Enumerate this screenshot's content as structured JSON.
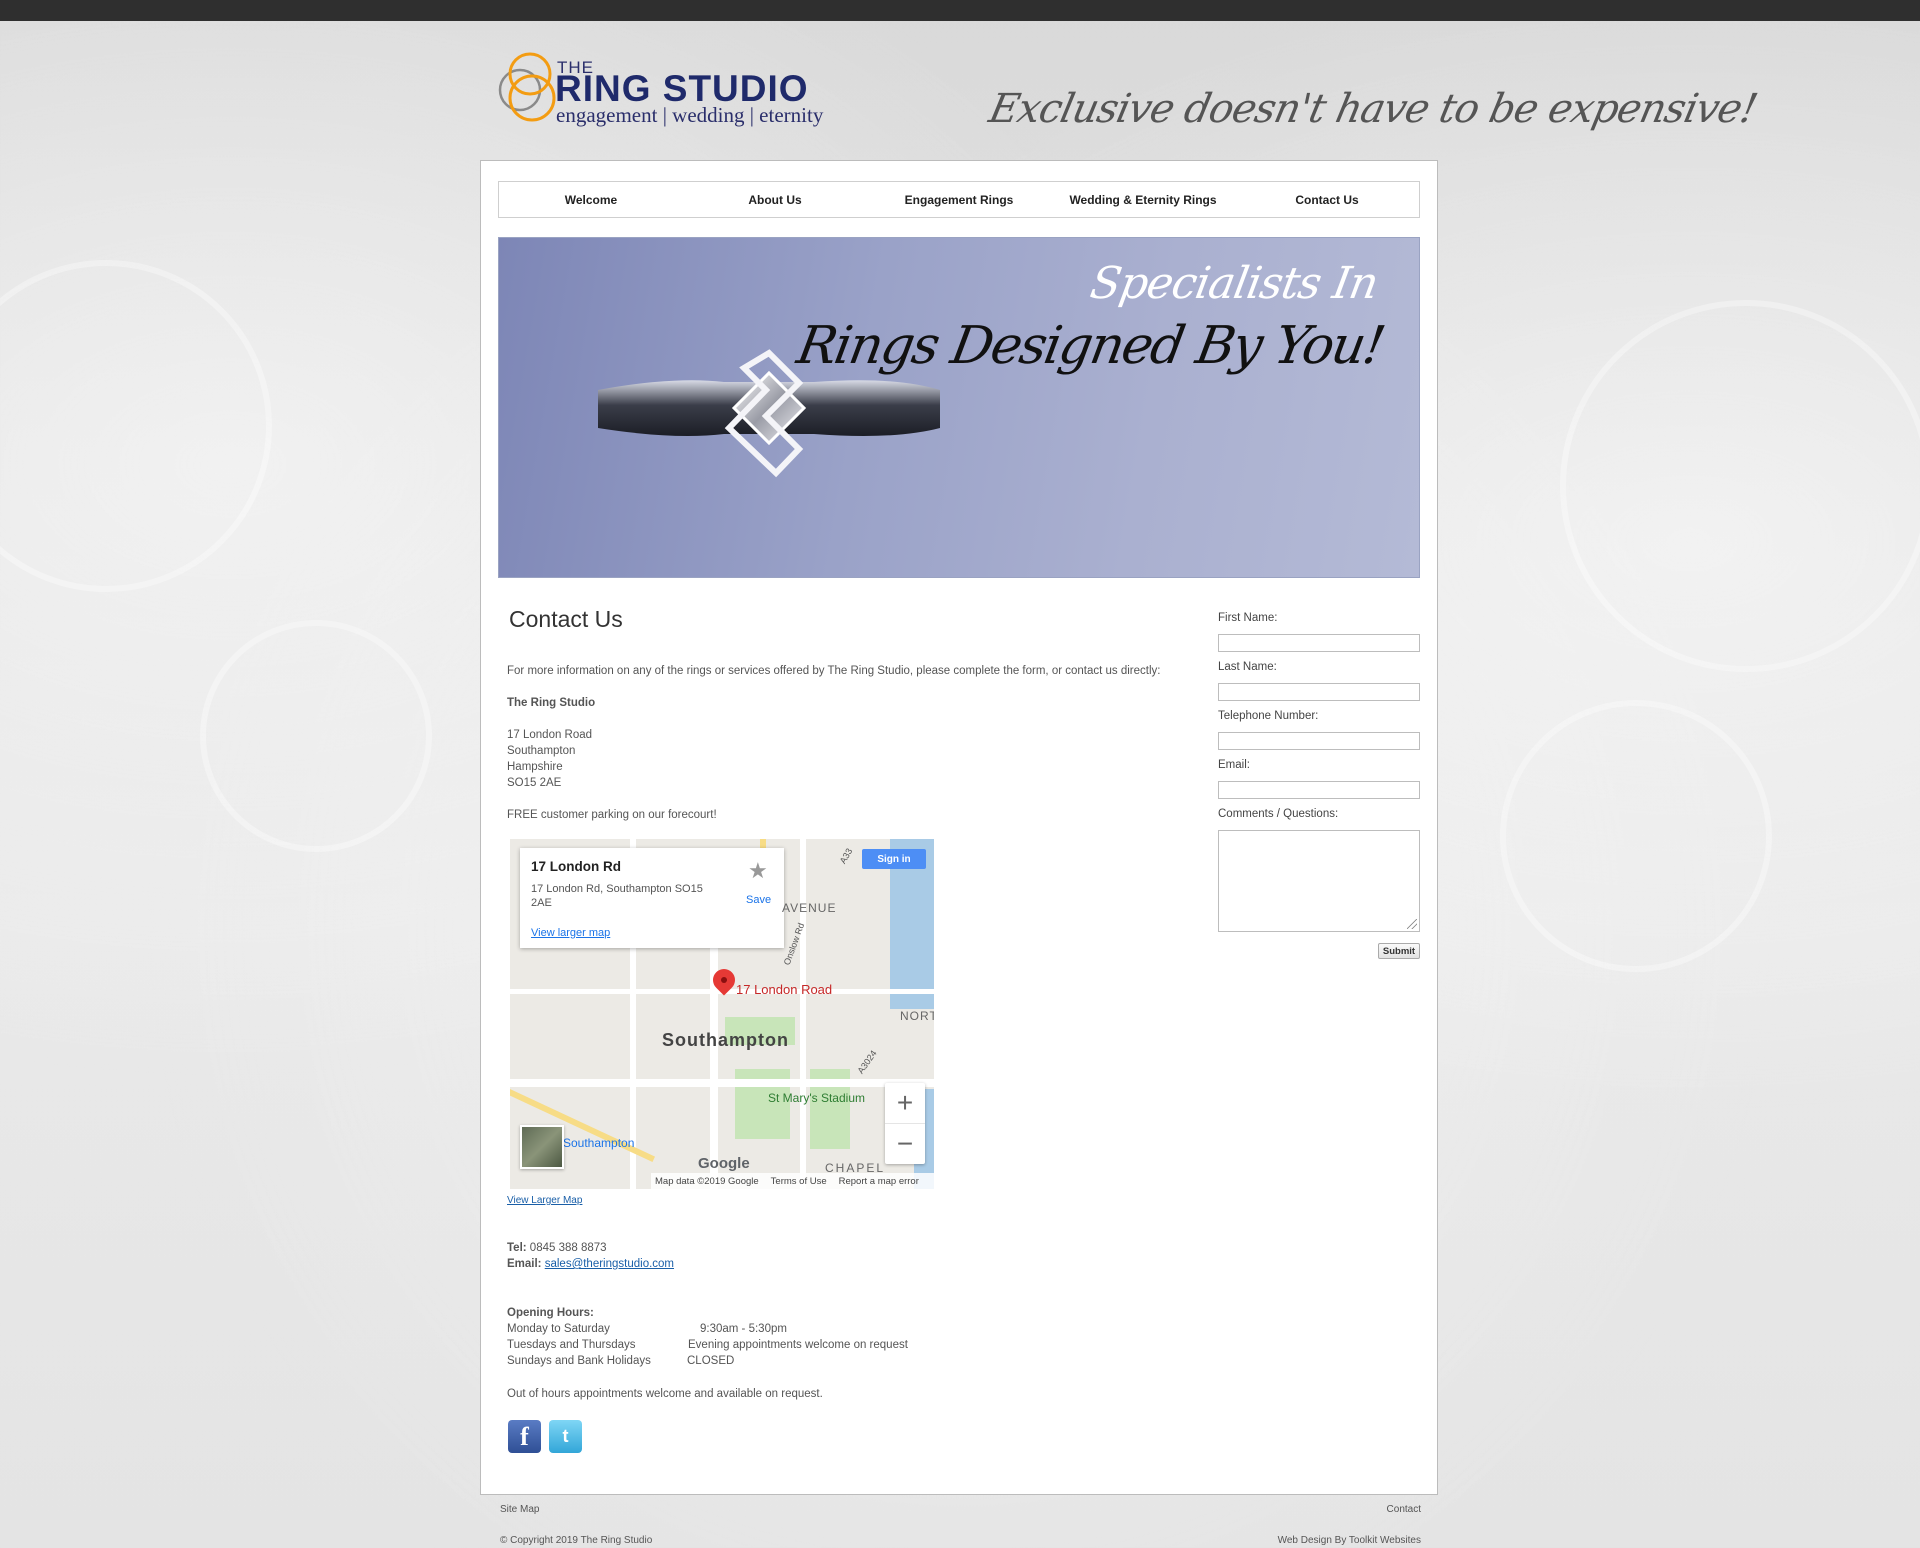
{
  "header": {
    "logo_the": "THE",
    "logo_main": "RING STUDIO",
    "logo_sub": "engagement | wedding | eternity",
    "tagline": "Exclusive doesn't have to be expensive!"
  },
  "nav": [
    "Welcome",
    "About Us",
    "Engagement Rings",
    "Wedding & Eternity Rings",
    "Contact Us"
  ],
  "banner": {
    "line1": "Specialists In",
    "line2": "Rings Designed By You!"
  },
  "content": {
    "title": "Contact Us",
    "intro": "For more information on any of the rings or services offered by The Ring Studio, please complete the form, or contact us directly:",
    "company": "The Ring Studio",
    "address": [
      "17 London Road",
      "Southampton",
      "Hampshire",
      "SO15 2AE"
    ],
    "parking": "FREE customer parking on our forecourt!",
    "view_larger_map": "View Larger Map",
    "tel_label": "Tel:",
    "tel": "0845 388 8873",
    "email_label": "Email:",
    "email": "sales@theringstudio.com",
    "hours_title": "Opening Hours:",
    "hours": [
      {
        "day": "Monday to Saturday",
        "time": "9:30am   - 5:30pm"
      },
      {
        "day": "Tuesdays and Thursdays",
        "time": "Evening appointments welcome on request"
      },
      {
        "day": "Sundays and Bank Holidays",
        "time": "CLOSED"
      }
    ],
    "out_of_hours": "Out of hours appointments welcome and available on request."
  },
  "map": {
    "card_title": "17 London Rd",
    "card_address": "17 London Rd, Southampton SO15 2AE",
    "card_link": "View larger map",
    "save": "Save",
    "signin": "Sign in",
    "pin_label": "17 London Road",
    "city": "Southampton",
    "label_avenue": "AVENUE",
    "label_north": "NORT",
    "label_stadium": "St Mary's Stadium",
    "label_station": "Southampton",
    "label_chapel": "CHAPEL",
    "label_onslow": "Onslow Rd",
    "label_a3024": "A3024",
    "label_a33": "A33",
    "google": "Google",
    "foot_data": "Map data ©2019 Google",
    "foot_terms": "Terms of Use",
    "foot_report": "Report a map error",
    "zoom_in": "+",
    "zoom_out": "−"
  },
  "form": {
    "first_name": "First Name:",
    "last_name": "Last Name:",
    "telephone": "Telephone Number:",
    "email": "Email:",
    "comments": "Comments / Questions:",
    "submit": "Submit"
  },
  "social": {
    "facebook": "f",
    "twitter": "t"
  },
  "footer": {
    "site_map": "Site Map",
    "contact": "Contact",
    "copyright": "© Copyright 2019 The Ring Studio",
    "credit": "Web Design By Toolkit Websites"
  }
}
